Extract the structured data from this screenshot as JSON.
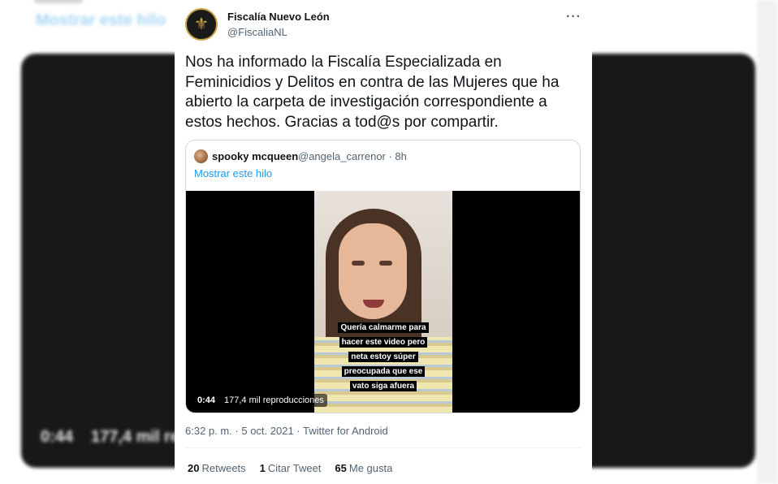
{
  "background": {
    "link_text": "Mostrar este hilo",
    "video_time": "0:44",
    "video_views": "177,4 mil re"
  },
  "tweet": {
    "author_name": "Fiscalía Nuevo León",
    "author_handle": "@FiscaliaNL",
    "more_icon": "more-icon",
    "text": "Nos ha informado la Fiscalía Especializada en Feminicidios y Delitos en contra de las Mujeres que ha abierto la carpeta de investigación correspondiente a estos hechos. Gracias a tod@s por compartir.",
    "timestamp": "6:32 p. m. · 5 oct. 2021 · Twitter for Android",
    "stats": {
      "retweets_count": "20",
      "retweets_label": "Retweets",
      "quotes_count": "1",
      "quotes_label": "Citar Tweet",
      "likes_count": "65",
      "likes_label": "Me gusta"
    }
  },
  "quoted": {
    "author_name": "spooky mcqueen",
    "author_handle": "@angela_carrenor · 8h",
    "thread_link": "Mostrar este hilo",
    "video": {
      "caption_lines": [
        "Quería calmarme para",
        "hacer este video pero",
        "neta estoy súper",
        "preocupada que ese",
        "vato siga afuera"
      ],
      "duration": "0:44",
      "views": "177,4 mil reproducciones"
    }
  },
  "colors": {
    "link": "#1d9bf0",
    "secondary_text": "#536471",
    "primary_text": "#0f1419"
  }
}
